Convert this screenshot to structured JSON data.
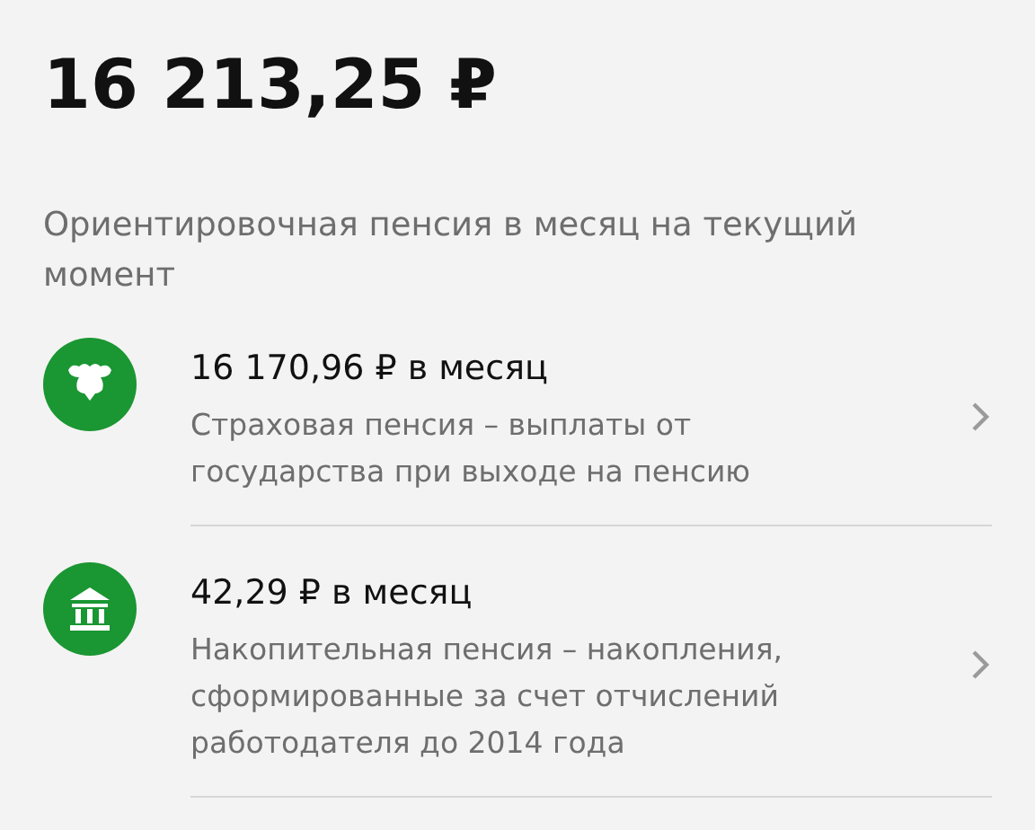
{
  "total": "16 213,25 ₽",
  "subtitle": "Ориентировочная пенсия в месяц на текущий момент",
  "items": [
    {
      "kind": "emblem",
      "amount": "16 170,96 ₽ в месяц",
      "description": "Страховая пенсия – выплаты от государства при выходе на пенсию"
    },
    {
      "kind": "bank",
      "amount": "42,29 ₽ в месяц",
      "description": "Накопительная пенсия – накопления, сформированные за счет отчислений работодателя до 2014 года"
    }
  ]
}
